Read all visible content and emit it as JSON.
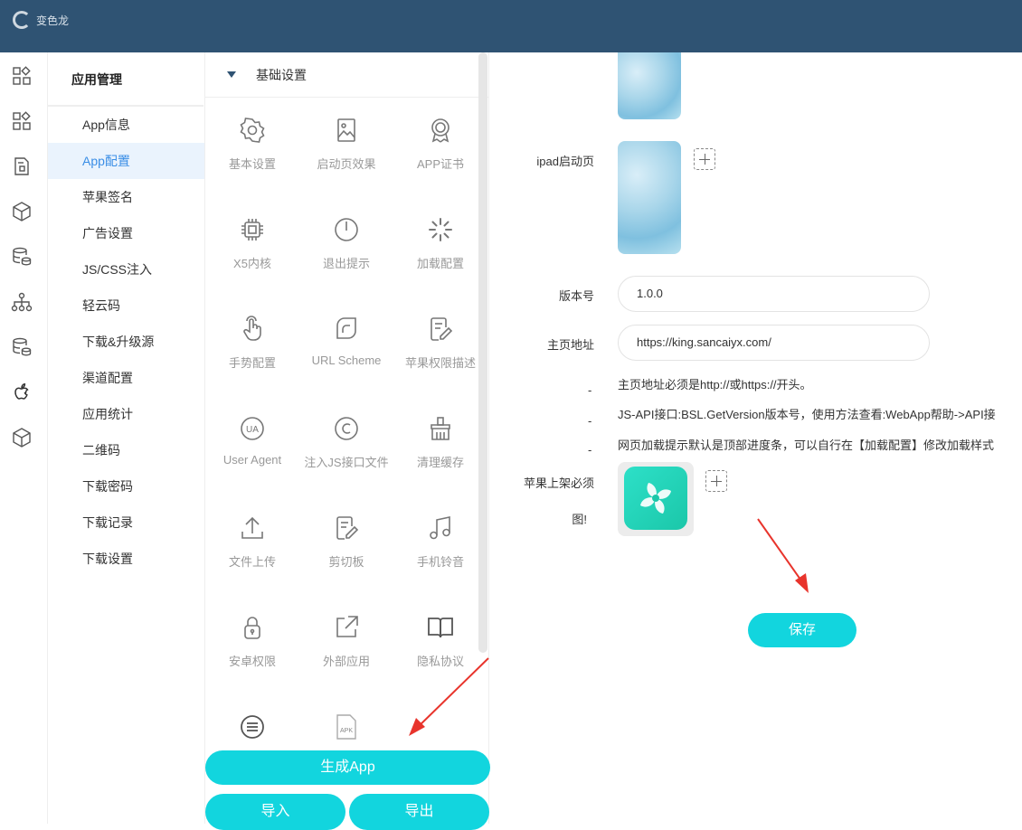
{
  "header": {
    "logo_text": "变色龙"
  },
  "rail_icons": [
    "apps-icon",
    "apps-icon",
    "document-icon",
    "cube-icon",
    "database-icon",
    "network-icon",
    "database-icon",
    "apple-icon",
    "cube-icon"
  ],
  "submenu": {
    "title": "应用管理",
    "items": [
      {
        "label": "App信息"
      },
      {
        "label": "App配置",
        "active": true
      },
      {
        "label": "苹果签名"
      },
      {
        "label": "广告设置"
      },
      {
        "label": "JS/CSS注入"
      },
      {
        "label": "轻云码"
      },
      {
        "label": "下载&升级源"
      },
      {
        "label": "渠道配置"
      },
      {
        "label": "应用统计"
      },
      {
        "label": "二维码"
      },
      {
        "label": "下载密码"
      },
      {
        "label": "下载记录"
      },
      {
        "label": "下载设置"
      }
    ]
  },
  "toolpanel": {
    "section_title": "基础设置",
    "tools": [
      {
        "label": "基本设置",
        "icon": "gear-icon"
      },
      {
        "label": "启动页效果",
        "icon": "image-icon"
      },
      {
        "label": "APP证书",
        "icon": "certificate-icon"
      },
      {
        "label": "X5内核",
        "icon": "chip-icon"
      },
      {
        "label": "退出提示",
        "icon": "power-icon"
      },
      {
        "label": "加载配置",
        "icon": "loading-icon"
      },
      {
        "label": "手势配置",
        "icon": "hand-icon"
      },
      {
        "label": "URL Scheme",
        "icon": "link-icon"
      },
      {
        "label": "苹果权限描述",
        "icon": "edit-icon"
      },
      {
        "label": "User Agent",
        "icon": "ua-icon"
      },
      {
        "label": "注入JS接口文件",
        "icon": "copyright-icon"
      },
      {
        "label": "清理缓存",
        "icon": "broom-icon"
      },
      {
        "label": "文件上传",
        "icon": "upload-icon"
      },
      {
        "label": "剪切板",
        "icon": "clipboard-icon"
      },
      {
        "label": "手机铃音",
        "icon": "music-icon"
      },
      {
        "label": "安卓权限",
        "icon": "lock-icon"
      },
      {
        "label": "外部应用",
        "icon": "external-link-icon"
      },
      {
        "label": "隐私协议",
        "icon": "book-icon"
      },
      {
        "label": "",
        "icon": "message-icon"
      },
      {
        "label": "",
        "icon": "apk-icon"
      }
    ],
    "apk_text": "APK",
    "ua_text": "UA",
    "buttons": {
      "generate": "生成App",
      "import": "导入",
      "export": "导出"
    }
  },
  "form": {
    "ipad_label": "ipad启动页",
    "version_label": "版本号",
    "version_value": "1.0.0",
    "homepage_label": "主页地址",
    "homepage_value": "https://king.sancaiyx.com/",
    "hints": [
      "主页地址必须是http://或https://开头。",
      "JS-API接口:BSL.GetVersion版本号，使用方法查看:WebApp帮助->API接",
      "网页加载提示默认是顶部进度条，可以自行在【加载配置】修改加载样式"
    ],
    "dash": "-",
    "apple_label_1": "苹果上架必须",
    "apple_label_2": "图!",
    "save": "保存"
  },
  "colors": {
    "header": "#2f5373",
    "accent": "#12d5de",
    "active_bg": "#eaf3fd",
    "active_text": "#3a8ee6",
    "arrow": "#e8342c"
  }
}
